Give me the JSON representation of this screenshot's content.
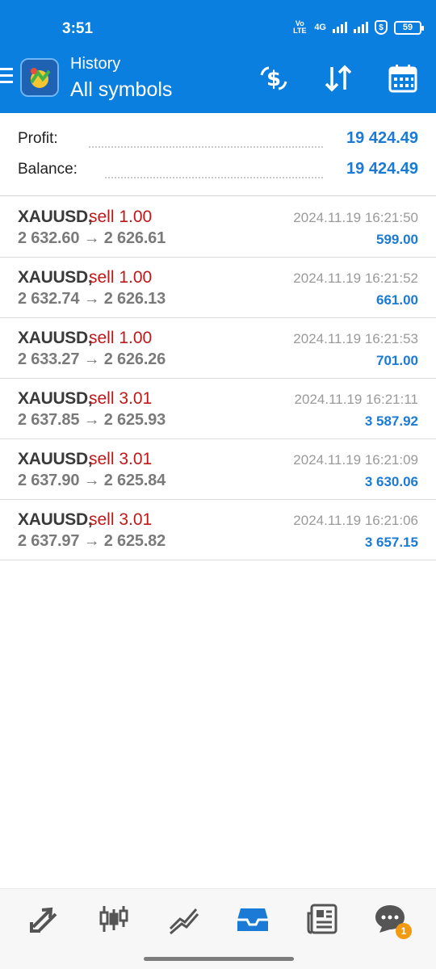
{
  "status": {
    "time": "3:51",
    "network": "4G",
    "lte": "Vo LTE",
    "battery": "59"
  },
  "header": {
    "subtitle": "History",
    "title": "All symbols"
  },
  "summary": [
    {
      "label": "Profit:",
      "value": "19 424.49"
    },
    {
      "label": "Balance:",
      "value": "19 424.49"
    }
  ],
  "deals": [
    {
      "symbol": "XAUUSD,",
      "type": "sell 1.00",
      "prices": "2 632.60 → 2 626.61",
      "time": "2024.11.19 16:21:50",
      "profit": "599.00"
    },
    {
      "symbol": "XAUUSD,",
      "type": "sell 1.00",
      "prices": "2 632.74 → 2 626.13",
      "time": "2024.11.19 16:21:52",
      "profit": "661.00"
    },
    {
      "symbol": "XAUUSD,",
      "type": "sell 1.00",
      "prices": "2 633.27 → 2 626.26",
      "time": "2024.11.19 16:21:53",
      "profit": "701.00"
    },
    {
      "symbol": "XAUUSD,",
      "type": "sell 3.01",
      "prices": "2 637.85 → 2 625.93",
      "time": "2024.11.19 16:21:11",
      "profit": "3 587.92"
    },
    {
      "symbol": "XAUUSD,",
      "type": "sell 3.01",
      "prices": "2 637.90 → 2 625.84",
      "time": "2024.11.19 16:21:09",
      "profit": "3 630.06"
    },
    {
      "symbol": "XAUUSD,",
      "type": "sell 3.01",
      "prices": "2 637.97 → 2 625.82",
      "time": "2024.11.19 16:21:06",
      "profit": "3 657.15"
    }
  ],
  "nav": {
    "items": [
      "quotes-icon",
      "chart-icon",
      "trade-icon",
      "history-icon",
      "news-icon",
      "chat-icon"
    ],
    "active_color": "#1a7ad6",
    "chat_badge": "1"
  },
  "colors": {
    "brand": "#0b7fe0",
    "profit": "#1a7ad6",
    "sell": "#c01818"
  }
}
